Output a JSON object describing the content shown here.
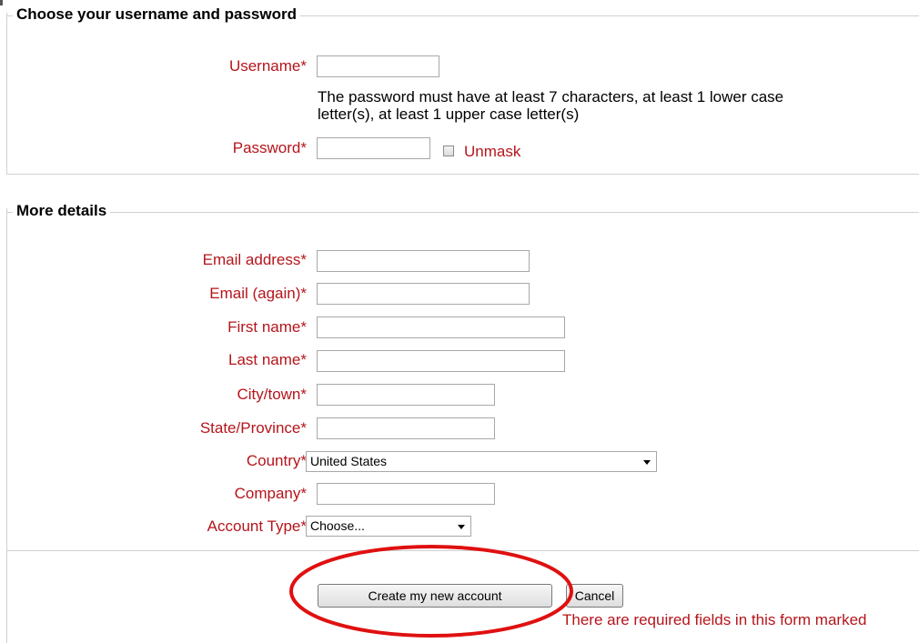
{
  "section1": {
    "legend": "Choose your username and password",
    "username_label": "Username*",
    "username_value": "",
    "password_hint_line1": "The password must have at least 7 characters, at least 1 lower case",
    "password_hint_line2": "letter(s), at least 1 upper case letter(s)",
    "password_label": "Password*",
    "password_value": "",
    "unmask_label": "Unmask"
  },
  "section2": {
    "legend": "More details",
    "email_label": "Email address*",
    "email_again_label": "Email (again)*",
    "firstname_label": "First name*",
    "lastname_label": "Last name*",
    "city_label": "City/town*",
    "state_label": "State/Province*",
    "country_label": "Country*",
    "country_value": "United States",
    "company_label": "Company*",
    "account_type_label": "Account Type*",
    "account_type_value": "Choose..."
  },
  "actions": {
    "create_label": "Create my new account",
    "cancel_label": "Cancel",
    "required_note": "There are required fields in this form marked"
  },
  "colors": {
    "label_red": "#b5151b",
    "annotation_red": "#e01010"
  }
}
